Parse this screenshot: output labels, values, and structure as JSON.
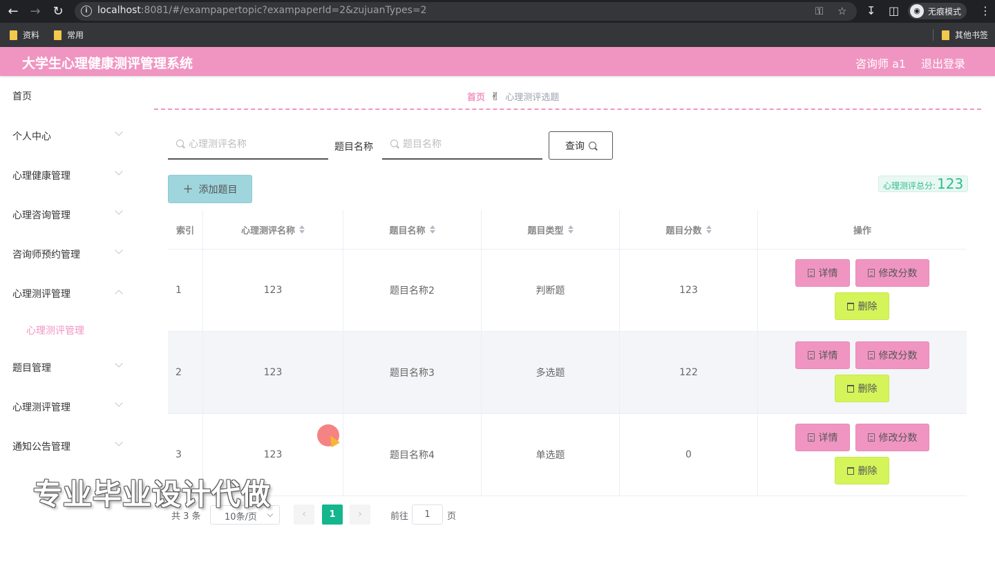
{
  "browser": {
    "url_host": "localhost",
    "url_rest": ":8081/#/exampapertopic?exampaperId=2&zujuanTypes=2",
    "incognito_label": "无痕模式",
    "bookmarks": [
      "资料",
      "常用"
    ],
    "other_bookmarks": "其他书签"
  },
  "header": {
    "title": "大学生心理健康测评管理系统",
    "user": "咨询师 a1",
    "logout": "退出登录"
  },
  "sidebar": {
    "items": [
      "首页",
      "个人中心",
      "心理健康管理",
      "心理咨询管理",
      "咨询师预约管理",
      "心理测评管理",
      "题目管理",
      "心理测评管理",
      "通知公告管理"
    ],
    "submenu": "心理测评管理"
  },
  "breadcrumb": {
    "home": "首页",
    "current": "心理测评选题"
  },
  "search": {
    "name_placeholder": "心理测评名称",
    "topic_label": "题目名称",
    "topic_placeholder": "题目名称",
    "query_label": "查询"
  },
  "toolbar": {
    "add_label": "添加题目",
    "total_label": "心理测评总分:",
    "total_value": "123"
  },
  "table": {
    "headers": [
      "索引",
      "心理测评名称",
      "题目名称",
      "题目类型",
      "题目分数",
      "操作"
    ],
    "rows": [
      {
        "index": "1",
        "exam": "123",
        "topic": "题目名称2",
        "type": "判断题",
        "score": "123"
      },
      {
        "index": "2",
        "exam": "123",
        "topic": "题目名称3",
        "type": "多选题",
        "score": "122"
      },
      {
        "index": "3",
        "exam": "123",
        "topic": "题目名称4",
        "type": "单选题",
        "score": "0"
      }
    ],
    "actions": {
      "detail": "详情",
      "edit_score": "修改分数",
      "delete": "删除"
    }
  },
  "pagination": {
    "total": "共 3 条",
    "page_size": "10条/页",
    "current_page": "1",
    "goto_label": "前往",
    "goto_value": "1",
    "page_unit": "页"
  },
  "watermark": "专业毕业设计代做"
}
